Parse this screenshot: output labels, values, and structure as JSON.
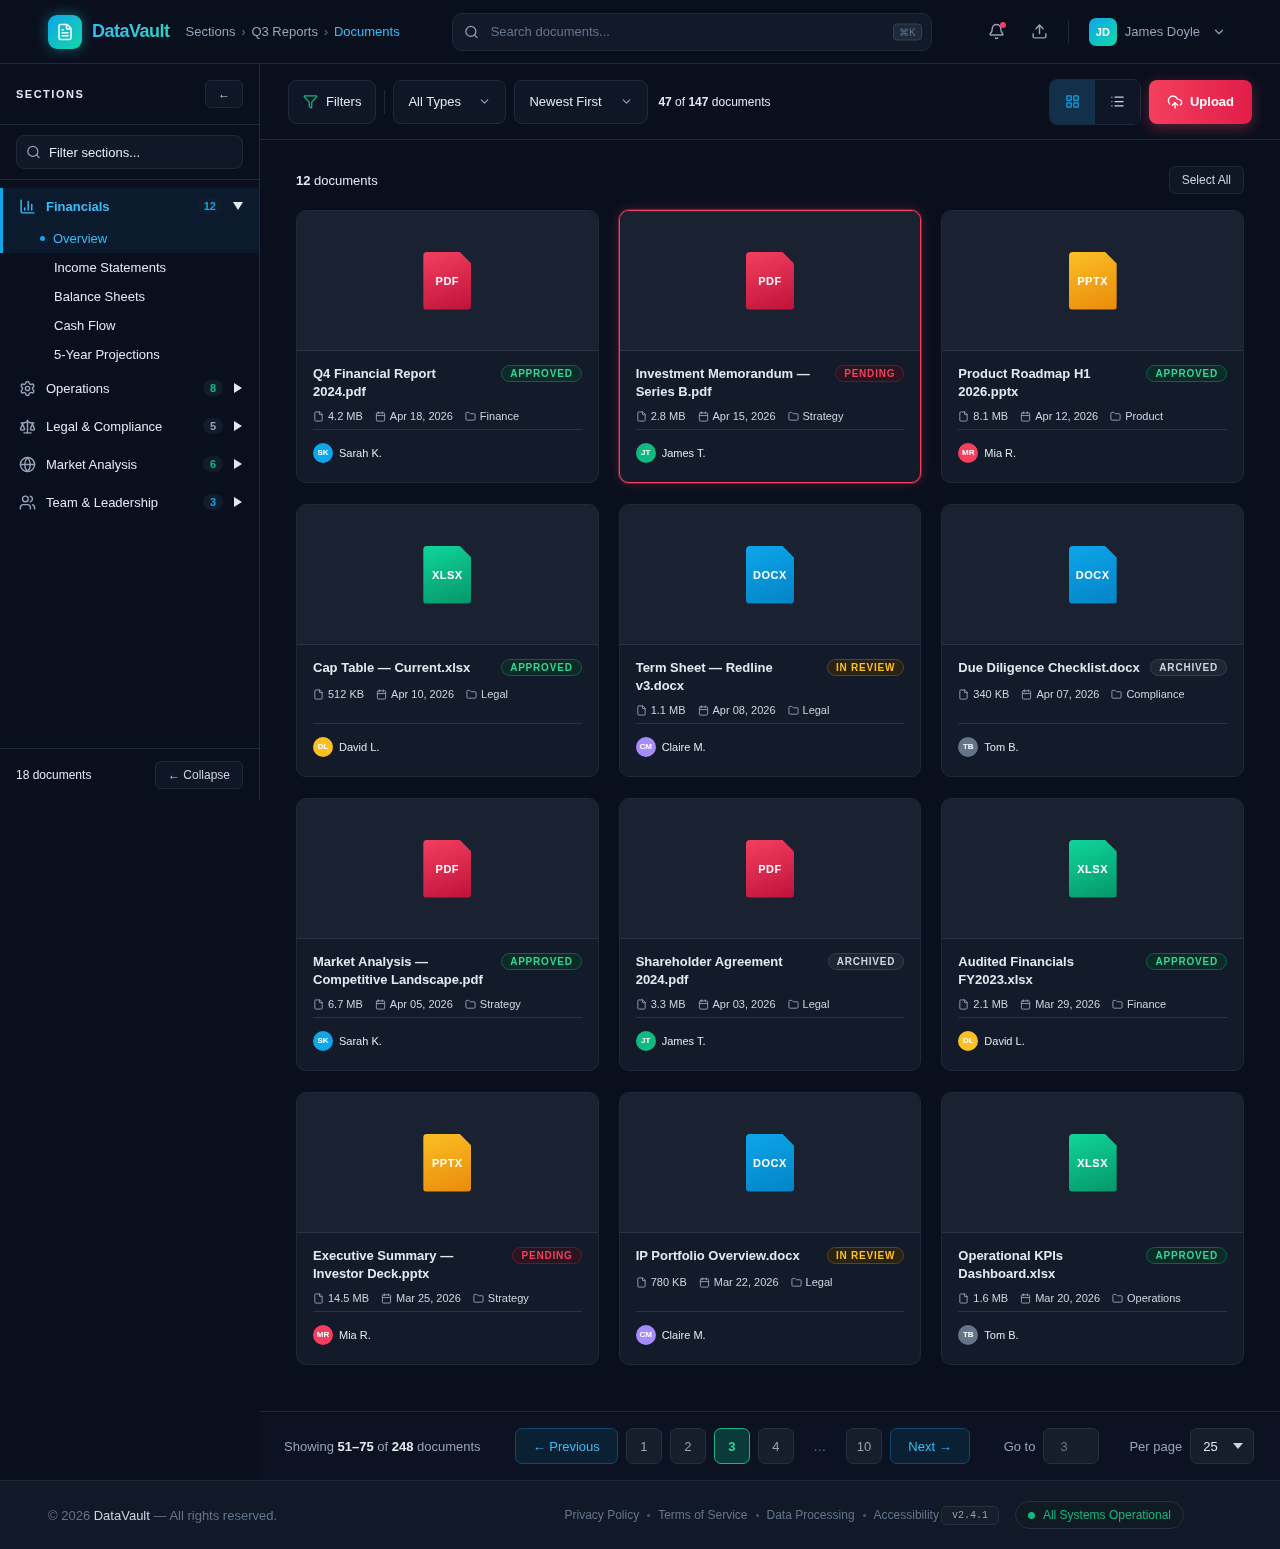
{
  "header": {
    "brand": "DataVault",
    "breadcrumb_separator": "›",
    "breadcrumbs": [
      {
        "label": "Sections",
        "selected": false
      },
      {
        "label": "Q3 Reports",
        "selected": false
      },
      {
        "label": "Documents",
        "selected": true
      }
    ],
    "search": {
      "placeholder": "Search documents...",
      "shortcut": "⌘K"
    },
    "notifications": {
      "unread": true
    },
    "user": {
      "initials": "JD",
      "name": "James Doyle"
    }
  },
  "sidebar": {
    "title": "SECTIONS",
    "collapse_glyph": "←",
    "filter": {
      "placeholder": "Filter sections..."
    },
    "items": [
      {
        "label": "Financials",
        "count": "12",
        "expanded": true,
        "selected": true,
        "color": "#0ea5e9",
        "children": [
          {
            "label": "Overview",
            "selected": true
          },
          {
            "label": "Income Statements",
            "selected": false
          },
          {
            "label": "Balance Sheets",
            "selected": false
          },
          {
            "label": "Cash Flow",
            "selected": false
          },
          {
            "label": "5-Year Projections",
            "selected": false
          }
        ]
      },
      {
        "label": "Operations",
        "count": "8",
        "expanded": false,
        "selected": false,
        "color": "#10b981"
      },
      {
        "label": "Legal & Compliance",
        "count": "5",
        "expanded": false,
        "selected": false,
        "color": "#94a3b8"
      },
      {
        "label": "Market Analysis",
        "count": "6",
        "expanded": false,
        "selected": false,
        "color": "#10b981"
      },
      {
        "label": "Team & Leadership",
        "count": "3",
        "expanded": false,
        "selected": false,
        "color": "#0ea5e9"
      }
    ],
    "footer_count": "18 documents",
    "collapse_button": "← Collapse"
  },
  "toolbar": {
    "filters": "Filters",
    "type_select": "All Types",
    "sort_select": "Newest First",
    "summary": "**47** of **147** documents",
    "views": [
      {
        "kind": "grid",
        "selected": true
      },
      {
        "kind": "list",
        "selected": false
      }
    ],
    "upload": "Upload"
  },
  "grid": {
    "count": "**12** documents",
    "select_all": "Select All",
    "cards": [
      {
        "kind": "pdf",
        "type_label": "PDF",
        "title": "Q4 Financial Report 2024.pdf",
        "status": {
          "label": "APPROVED",
          "kind": "success"
        },
        "size": "4.2 MB",
        "date": "Apr 18, 2026",
        "folder": "Finance",
        "initials": "SK",
        "author": "Sarah K.",
        "color": "#0ea5e9",
        "selected": false
      },
      {
        "kind": "pdf",
        "type_label": "PDF",
        "title": "Investment Memorandum — Series B.pdf",
        "status": {
          "label": "PENDING",
          "kind": "danger"
        },
        "size": "2.8 MB",
        "date": "Apr 15, 2026",
        "folder": "Strategy",
        "initials": "JT",
        "author": "James T.",
        "color": "#10b981",
        "selected": true
      },
      {
        "kind": "pptx",
        "type_label": "PPTX",
        "title": "Product Roadmap H1 2026.pptx",
        "status": {
          "label": "APPROVED",
          "kind": "success"
        },
        "size": "8.1 MB",
        "date": "Apr 12, 2026",
        "folder": "Product",
        "initials": "MR",
        "author": "Mia R.",
        "color": "#f43f5e",
        "selected": false
      },
      {
        "kind": "xlsx",
        "type_label": "XLSX",
        "title": "Cap Table — Current.xlsx",
        "status": {
          "label": "APPROVED",
          "kind": "success"
        },
        "size": "512 KB",
        "date": "Apr 10, 2026",
        "folder": "Legal",
        "initials": "DL",
        "author": "David L.",
        "color": "#fbbf24",
        "selected": false
      },
      {
        "kind": "docx",
        "type_label": "DOCX",
        "title": "Term Sheet — Redline v3.docx",
        "status": {
          "label": "IN REVIEW",
          "kind": "warning"
        },
        "size": "1.1 MB",
        "date": "Apr 08, 2026",
        "folder": "Legal",
        "initials": "CM",
        "author": "Claire M.",
        "color": "#a78bfa",
        "selected": false
      },
      {
        "kind": "docx",
        "type_label": "DOCX",
        "title": "Due Diligence Checklist.docx",
        "status": {
          "label": "ARCHIVED",
          "kind": "neutral"
        },
        "size": "340 KB",
        "date": "Apr 07, 2026",
        "folder": "Compliance",
        "initials": "TB",
        "author": "Tom B.",
        "color": "#64748b",
        "selected": false
      },
      {
        "kind": "pdf",
        "type_label": "PDF",
        "title": "Market Analysis — Competitive Landscape.pdf",
        "status": {
          "label": "APPROVED",
          "kind": "success"
        },
        "size": "6.7 MB",
        "date": "Apr 05, 2026",
        "folder": "Strategy",
        "initials": "SK",
        "author": "Sarah K.",
        "color": "#0ea5e9",
        "selected": false
      },
      {
        "kind": "pdf",
        "type_label": "PDF",
        "title": "Shareholder Agreement 2024.pdf",
        "status": {
          "label": "ARCHIVED",
          "kind": "neutral"
        },
        "size": "3.3 MB",
        "date": "Apr 03, 2026",
        "folder": "Legal",
        "initials": "JT",
        "author": "James T.",
        "color": "#10b981",
        "selected": false
      },
      {
        "kind": "xlsx",
        "type_label": "XLSX",
        "title": "Audited Financials FY2023.xlsx",
        "status": {
          "label": "APPROVED",
          "kind": "success"
        },
        "size": "2.1 MB",
        "date": "Mar 29, 2026",
        "folder": "Finance",
        "initials": "DL",
        "author": "David L.",
        "color": "#fbbf24",
        "selected": false
      },
      {
        "kind": "pptx",
        "type_label": "PPTX",
        "title": "Executive Summary — Investor Deck.pptx",
        "status": {
          "label": "PENDING",
          "kind": "danger"
        },
        "size": "14.5 MB",
        "date": "Mar 25, 2026",
        "folder": "Strategy",
        "initials": "MR",
        "author": "Mia R.",
        "color": "#f43f5e",
        "selected": false
      },
      {
        "kind": "docx",
        "type_label": "DOCX",
        "title": "IP Portfolio Overview.docx",
        "status": {
          "label": "IN REVIEW",
          "kind": "warning"
        },
        "size": "780 KB",
        "date": "Mar 22, 2026",
        "folder": "Legal",
        "initials": "CM",
        "author": "Claire M.",
        "color": "#a78bfa",
        "selected": false
      },
      {
        "kind": "xlsx",
        "type_label": "XLSX",
        "title": "Operational KPIs Dashboard.xlsx",
        "status": {
          "label": "APPROVED",
          "kind": "success"
        },
        "size": "1.6 MB",
        "date": "Mar 20, 2026",
        "folder": "Operations",
        "initials": "TB",
        "author": "Tom B.",
        "color": "#64748b",
        "selected": false
      }
    ]
  },
  "pagination": {
    "summary": "Showing **51–75** of **248** documents",
    "previous": "← Previous",
    "pages": [
      {
        "kind": "page",
        "label": "1",
        "selected": false
      },
      {
        "kind": "page",
        "label": "2",
        "selected": false
      },
      {
        "kind": "page",
        "label": "3",
        "selected": true
      },
      {
        "kind": "page",
        "label": "4",
        "selected": false
      },
      {
        "kind": "gap",
        "label": "…"
      },
      {
        "kind": "page",
        "label": "10",
        "selected": false
      }
    ],
    "next": "Next →",
    "goto_label": "Go to",
    "goto": {
      "placeholder": "3"
    },
    "per_page_label": "Per page",
    "per_page": "25"
  },
  "footer": {
    "copyright": "© 2026 **DataVault** — All rights reserved.",
    "links": [
      "Privacy Policy",
      "Terms of Service",
      "Data Processing",
      "Accessibility"
    ],
    "version": "v2.4.1",
    "status": "All Systems Operational"
  }
}
